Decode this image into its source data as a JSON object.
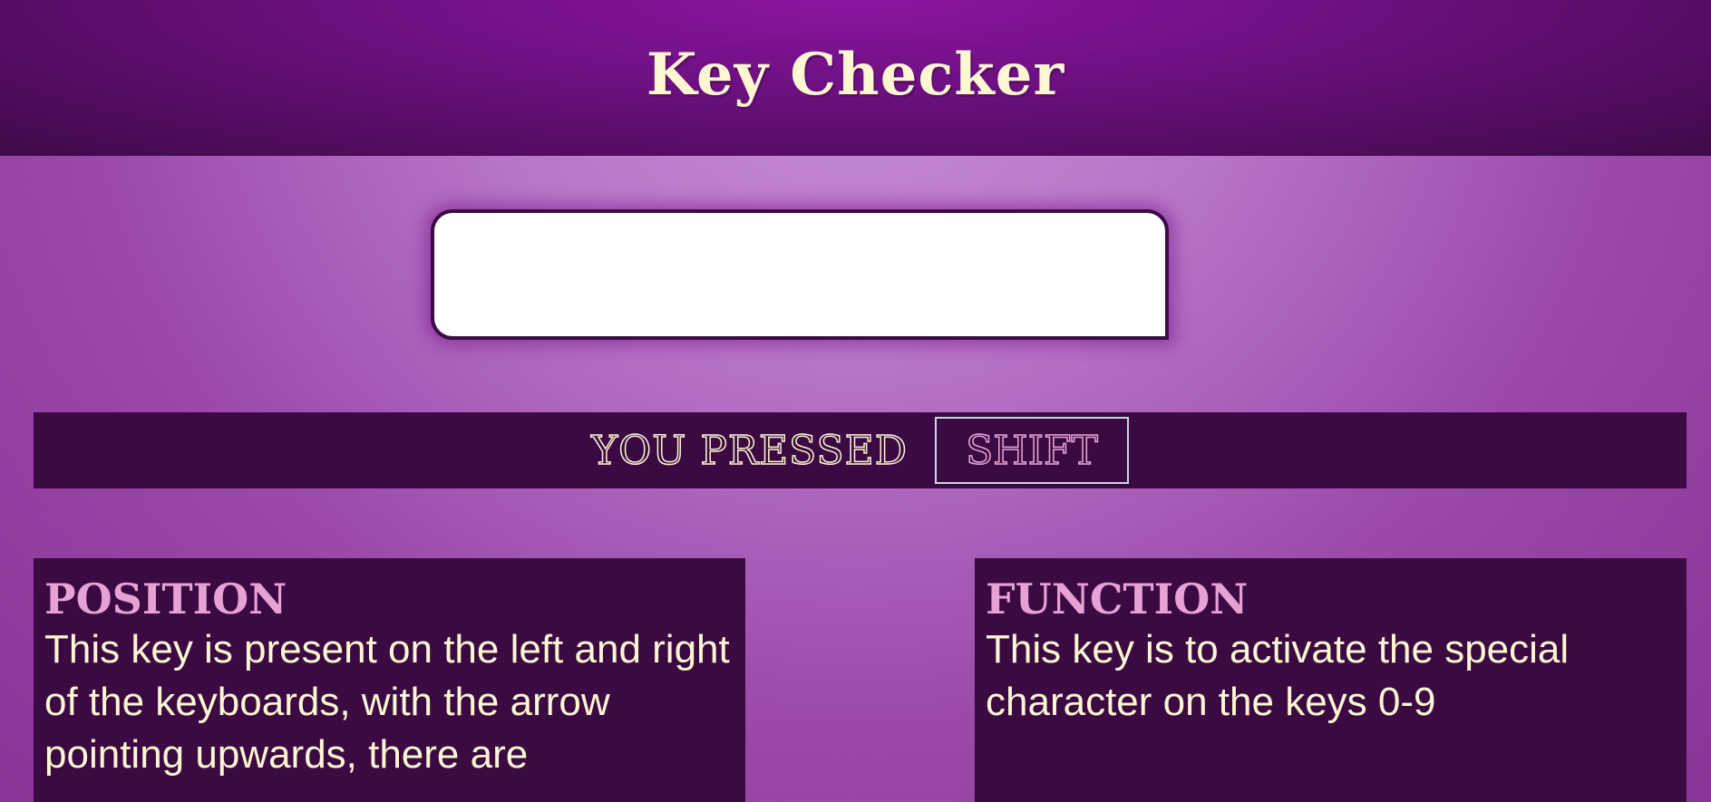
{
  "header": {
    "title": "Key Checker"
  },
  "input": {
    "value": "",
    "placeholder": ""
  },
  "result": {
    "label": "YOU PRESSED",
    "key": "SHIFT"
  },
  "position_panel": {
    "heading": "POSITION",
    "text": "This key is present on the left and right of the keyboards, with the arrow pointing upwards, there are"
  },
  "function_panel": {
    "heading": "FUNCTION",
    "text": "This key is to activate the special character on the keys 0-9"
  },
  "colors": {
    "header_dark": "#3e0a48",
    "header_center": "#8c16a0",
    "panel_background": "#3b0a42",
    "title_text": "#fff6d2",
    "heading_pink": "#e6a2d6",
    "page_background": "#a858b8"
  }
}
